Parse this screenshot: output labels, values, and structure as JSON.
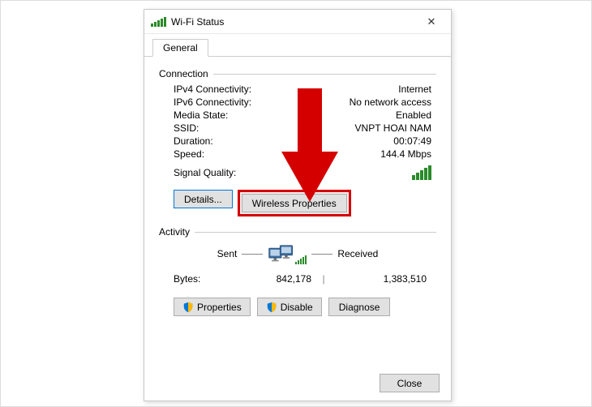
{
  "title": "Wi-Fi Status",
  "tab": "General",
  "groups": {
    "connection": "Connection",
    "activity": "Activity"
  },
  "conn": {
    "ipv4_lbl": "IPv4 Connectivity:",
    "ipv4_val": "Internet",
    "ipv6_lbl": "IPv6 Connectivity:",
    "ipv6_val": "No network access",
    "media_lbl": "Media State:",
    "media_val": "Enabled",
    "ssid_lbl": "SSID:",
    "ssid_val": "VNPT HOAI NAM",
    "dur_lbl": "Duration:",
    "dur_val": "00:07:49",
    "speed_lbl": "Speed:",
    "speed_val": "144.4 Mbps",
    "sigq_lbl": "Signal Quality:"
  },
  "buttons": {
    "details": "Details...",
    "wprops": "Wireless Properties",
    "properties": "Properties",
    "disable": "Disable",
    "diagnose": "Diagnose",
    "close": "Close"
  },
  "activity": {
    "sent_lbl": "Sent",
    "recv_lbl": "Received",
    "bytes_lbl": "Bytes:",
    "sent_val": "842,178",
    "recv_val": "1,383,510"
  }
}
